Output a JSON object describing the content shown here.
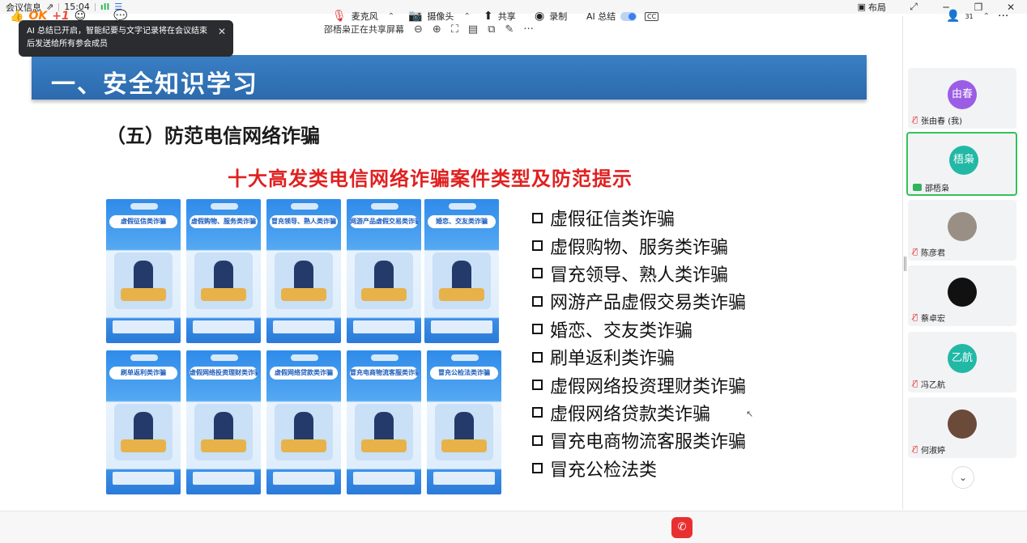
{
  "topbar": {
    "meeting_info": "会议信息",
    "time": "15:04",
    "layout_label": "布局"
  },
  "share_bar": {
    "sharing_text": "邵梧枭正在共享屏幕"
  },
  "toast": {
    "message": "AI 总结已开启，智能纪要与文字记录将在会议结束后发送给所有参会成员"
  },
  "slide": {
    "header": "一、安全知识学习",
    "subtitle": "（五）防范电信网络诈骗",
    "red_title": "十大高发类电信网络诈骗案件类型及防范提示",
    "posters": [
      {
        "title": "虚假征信类诈骗"
      },
      {
        "title": "虚假购物、服务类诈骗"
      },
      {
        "title": "冒充领导、熟人类诈骗"
      },
      {
        "title": "网游产品虚假交易类诈骗"
      },
      {
        "title": "婚恋、交友类诈骗"
      },
      {
        "title": "刷单返利类诈骗"
      },
      {
        "title": "虚假网络投资理财类诈骗"
      },
      {
        "title": "虚假网络贷款类诈骗"
      },
      {
        "title": "冒充电商物流客服类诈骗"
      },
      {
        "title": "冒充公检法类诈骗"
      }
    ],
    "checklist": [
      "虚假征信类诈骗",
      "虚假购物、服务类诈骗",
      "冒充领导、熟人类诈骗",
      "网游产品虚假交易类诈骗",
      "婚恋、交友类诈骗",
      "刷单返利类诈骗",
      "虚假网络投资理财类诈骗",
      "虚假网络贷款类诈骗",
      "冒充电商物流客服类诈骗",
      "冒充公检法类"
    ]
  },
  "participants": [
    {
      "avatar_text": "由春",
      "avatar_color": "#9b5de5",
      "name": "张由春 (我)",
      "mic": "muted"
    },
    {
      "avatar_text": "梧枭",
      "avatar_color": "#22b8a6",
      "name": "邵梧枭",
      "mic": "sharing"
    },
    {
      "avatar_text": "",
      "avatar_color": "#9a8f84",
      "name": "陈彦君",
      "mic": "muted"
    },
    {
      "avatar_text": "",
      "avatar_color": "#111111",
      "name": "蔡卓宏",
      "mic": "muted"
    },
    {
      "avatar_text": "乙航",
      "avatar_color": "#22b8a6",
      "name": "冯乙航",
      "mic": "muted"
    },
    {
      "avatar_text": "",
      "avatar_color": "#6b4a3a",
      "name": "何淑婷",
      "mic": "muted"
    }
  ],
  "bottombar": {
    "reaction_ok": "OK",
    "reaction_plus": "+1",
    "mic_label": "麦克风",
    "camera_label": "摄像头",
    "share_label": "共享",
    "record_label": "录制",
    "ai_label": "AI 总结",
    "cc_label": "CC",
    "participants_count": "31"
  },
  "colors": {
    "slide_header": "#2f6fb3",
    "red_title": "#e02020",
    "active_border": "#34c25a",
    "end_call": "#e93030"
  }
}
